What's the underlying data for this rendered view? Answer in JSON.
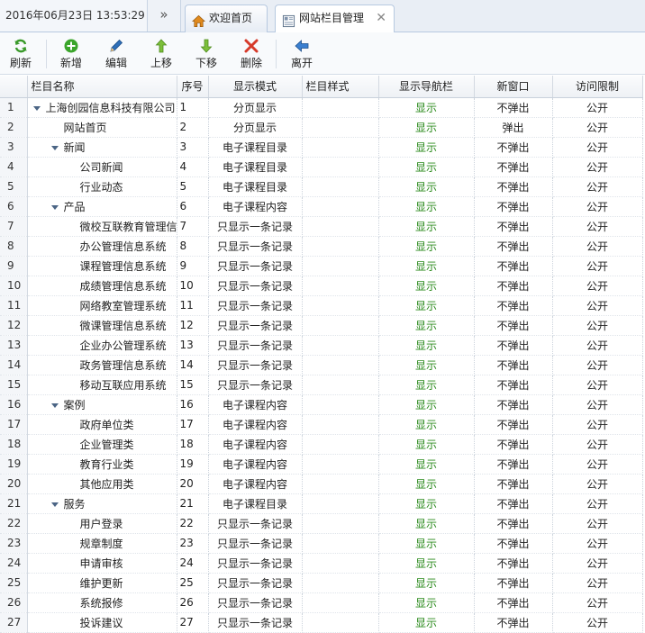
{
  "header": {
    "datetime": "2016年06月23日 13:53:29",
    "collapse_icon": "double-chevron-right-icon",
    "tabs": [
      {
        "label": "欢迎首页",
        "icon": "home-icon",
        "closable": false,
        "active": false
      },
      {
        "label": "网站栏目管理",
        "icon": "layout-icon",
        "closable": true,
        "active": true
      }
    ],
    "close_glyph": "✕"
  },
  "toolbar": {
    "buttons": [
      {
        "key": "refresh",
        "label": "刷新",
        "icon": "refresh-icon",
        "color": "#3a9a2a"
      },
      {
        "key": "add",
        "label": "新增",
        "icon": "plus-circle-icon",
        "color": "#3a9a2a"
      },
      {
        "key": "edit",
        "label": "编辑",
        "icon": "pencil-icon",
        "color": "#2f6fb8"
      },
      {
        "key": "up",
        "label": "上移",
        "icon": "arrow-up-icon",
        "color": "#6aa82a"
      },
      {
        "key": "down",
        "label": "下移",
        "icon": "arrow-down-icon",
        "color": "#6aa82a"
      },
      {
        "key": "delete",
        "label": "删除",
        "icon": "delete-x-icon",
        "color": "#d23a2a"
      },
      {
        "key": "exit",
        "label": "离开",
        "icon": "arrow-left-icon",
        "color": "#2f6fb8"
      }
    ]
  },
  "grid": {
    "columns": [
      "栏目名称",
      "序号",
      "显示模式",
      "栏目样式",
      "显示导航栏",
      "新窗口",
      "访问限制"
    ],
    "rows": [
      {
        "no": "1",
        "name": "上海创园信息科技有限公司",
        "level": 0,
        "expanded": true,
        "seq": "1",
        "mode": "分页显示",
        "style": "",
        "nav": "显示",
        "win": "不弹出",
        "access": "公开"
      },
      {
        "no": "2",
        "name": "网站首页",
        "level": 1,
        "expanded": false,
        "seq": "2",
        "mode": "分页显示",
        "style": "",
        "nav": "显示",
        "win": "弹出",
        "access": "公开"
      },
      {
        "no": "3",
        "name": "新闻",
        "level": 1,
        "expanded": true,
        "seq": "3",
        "mode": "电子课程目录",
        "style": "",
        "nav": "显示",
        "win": "不弹出",
        "access": "公开"
      },
      {
        "no": "4",
        "name": "公司新闻",
        "level": 2,
        "expanded": false,
        "seq": "4",
        "mode": "电子课程目录",
        "style": "",
        "nav": "显示",
        "win": "不弹出",
        "access": "公开"
      },
      {
        "no": "5",
        "name": "行业动态",
        "level": 2,
        "expanded": false,
        "seq": "5",
        "mode": "电子课程目录",
        "style": "",
        "nav": "显示",
        "win": "不弹出",
        "access": "公开"
      },
      {
        "no": "6",
        "name": "产品",
        "level": 1,
        "expanded": true,
        "seq": "6",
        "mode": "电子课程内容",
        "style": "",
        "nav": "显示",
        "win": "不弹出",
        "access": "公开"
      },
      {
        "no": "7",
        "name": "微校互联教育管理信",
        "level": 2,
        "expanded": false,
        "seq": "7",
        "mode": "只显示一条记录",
        "style": "",
        "nav": "显示",
        "win": "不弹出",
        "access": "公开"
      },
      {
        "no": "8",
        "name": "办公管理信息系统",
        "level": 2,
        "expanded": false,
        "seq": "8",
        "mode": "只显示一条记录",
        "style": "",
        "nav": "显示",
        "win": "不弹出",
        "access": "公开"
      },
      {
        "no": "9",
        "name": "课程管理信息系统",
        "level": 2,
        "expanded": false,
        "seq": "9",
        "mode": "只显示一条记录",
        "style": "",
        "nav": "显示",
        "win": "不弹出",
        "access": "公开"
      },
      {
        "no": "10",
        "name": "成绩管理信息系统",
        "level": 2,
        "expanded": false,
        "seq": "10",
        "mode": "只显示一条记录",
        "style": "",
        "nav": "显示",
        "win": "不弹出",
        "access": "公开"
      },
      {
        "no": "11",
        "name": "网络教室管理系统",
        "level": 2,
        "expanded": false,
        "seq": "11",
        "mode": "只显示一条记录",
        "style": "",
        "nav": "显示",
        "win": "不弹出",
        "access": "公开"
      },
      {
        "no": "12",
        "name": "微课管理信息系统",
        "level": 2,
        "expanded": false,
        "seq": "12",
        "mode": "只显示一条记录",
        "style": "",
        "nav": "显示",
        "win": "不弹出",
        "access": "公开"
      },
      {
        "no": "13",
        "name": "企业办公管理系统",
        "level": 2,
        "expanded": false,
        "seq": "13",
        "mode": "只显示一条记录",
        "style": "",
        "nav": "显示",
        "win": "不弹出",
        "access": "公开"
      },
      {
        "no": "14",
        "name": "政务管理信息系统",
        "level": 2,
        "expanded": false,
        "seq": "14",
        "mode": "只显示一条记录",
        "style": "",
        "nav": "显示",
        "win": "不弹出",
        "access": "公开"
      },
      {
        "no": "15",
        "name": "移动互联应用系统",
        "level": 2,
        "expanded": false,
        "seq": "15",
        "mode": "只显示一条记录",
        "style": "",
        "nav": "显示",
        "win": "不弹出",
        "access": "公开"
      },
      {
        "no": "16",
        "name": "案例",
        "level": 1,
        "expanded": true,
        "seq": "16",
        "mode": "电子课程内容",
        "style": "",
        "nav": "显示",
        "win": "不弹出",
        "access": "公开"
      },
      {
        "no": "17",
        "name": "政府单位类",
        "level": 2,
        "expanded": false,
        "seq": "17",
        "mode": "电子课程内容",
        "style": "",
        "nav": "显示",
        "win": "不弹出",
        "access": "公开"
      },
      {
        "no": "18",
        "name": "企业管理类",
        "level": 2,
        "expanded": false,
        "seq": "18",
        "mode": "电子课程内容",
        "style": "",
        "nav": "显示",
        "win": "不弹出",
        "access": "公开"
      },
      {
        "no": "19",
        "name": "教育行业类",
        "level": 2,
        "expanded": false,
        "seq": "19",
        "mode": "电子课程内容",
        "style": "",
        "nav": "显示",
        "win": "不弹出",
        "access": "公开"
      },
      {
        "no": "20",
        "name": "其他应用类",
        "level": 2,
        "expanded": false,
        "seq": "20",
        "mode": "电子课程内容",
        "style": "",
        "nav": "显示",
        "win": "不弹出",
        "access": "公开"
      },
      {
        "no": "21",
        "name": "服务",
        "level": 1,
        "expanded": true,
        "seq": "21",
        "mode": "电子课程目录",
        "style": "",
        "nav": "显示",
        "win": "不弹出",
        "access": "公开"
      },
      {
        "no": "22",
        "name": "用户登录",
        "level": 2,
        "expanded": false,
        "seq": "22",
        "mode": "只显示一条记录",
        "style": "",
        "nav": "显示",
        "win": "不弹出",
        "access": "公开"
      },
      {
        "no": "23",
        "name": "规章制度",
        "level": 2,
        "expanded": false,
        "seq": "23",
        "mode": "只显示一条记录",
        "style": "",
        "nav": "显示",
        "win": "不弹出",
        "access": "公开"
      },
      {
        "no": "24",
        "name": "申请审核",
        "level": 2,
        "expanded": false,
        "seq": "24",
        "mode": "只显示一条记录",
        "style": "",
        "nav": "显示",
        "win": "不弹出",
        "access": "公开"
      },
      {
        "no": "25",
        "name": "维护更新",
        "level": 2,
        "expanded": false,
        "seq": "25",
        "mode": "只显示一条记录",
        "style": "",
        "nav": "显示",
        "win": "不弹出",
        "access": "公开"
      },
      {
        "no": "26",
        "name": "系统报修",
        "level": 2,
        "expanded": false,
        "seq": "26",
        "mode": "只显示一条记录",
        "style": "",
        "nav": "显示",
        "win": "不弹出",
        "access": "公开"
      },
      {
        "no": "27",
        "name": "投诉建议",
        "level": 2,
        "expanded": false,
        "seq": "27",
        "mode": "只显示一条记录",
        "style": "",
        "nav": "显示",
        "win": "不弹出",
        "access": "公开"
      }
    ]
  },
  "colors": {
    "nav_text": "#2a8a1b",
    "tab_border": "#b7c9e0",
    "home_icon": "#e08a1e"
  }
}
